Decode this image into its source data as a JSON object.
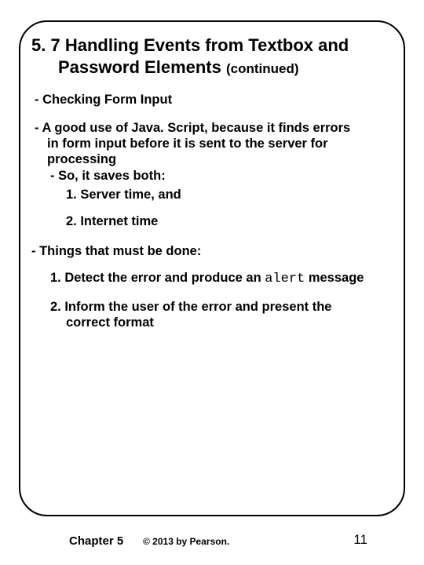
{
  "title": {
    "number": "5. 7",
    "line1": "Handling Events from Textbox and",
    "line2": "Password Elements",
    "continued": "(continued)"
  },
  "body": {
    "checking": "- Checking Form Input",
    "good_use_l1": "- A good use of Java. Script, because it finds errors",
    "good_use_l2": "in form input before it is sent to the server for",
    "good_use_l3": "processing",
    "saves": "- So, it saves both:",
    "save1": "1. Server time, and",
    "save2": "2. Internet time",
    "things": "- Things that must be done:",
    "detect_pre": "1. Detect the error and produce an ",
    "detect_mono": "alert",
    "detect_post": " message",
    "inform_l1": "2. Inform the user of the error and present the",
    "inform_l2": "correct format"
  },
  "footer": {
    "chapter": "Chapter 5",
    "copyright": "© 2013 by Pearson.",
    "page": "11"
  }
}
